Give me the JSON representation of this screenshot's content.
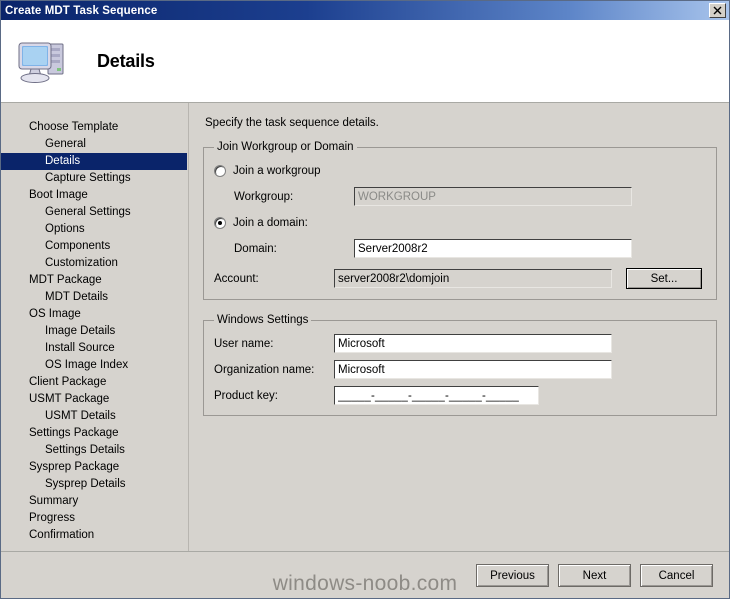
{
  "window": {
    "title": "Create MDT Task Sequence",
    "close_label": "✕"
  },
  "header": {
    "title": "Details",
    "icon": "computer-icon"
  },
  "sidebar": {
    "items": [
      {
        "label": "Choose Template",
        "level": 0,
        "selected": false
      },
      {
        "label": "General",
        "level": 1,
        "selected": false
      },
      {
        "label": "Details",
        "level": 1,
        "selected": true
      },
      {
        "label": "Capture Settings",
        "level": 1,
        "selected": false
      },
      {
        "label": "Boot Image",
        "level": 0,
        "selected": false
      },
      {
        "label": "General Settings",
        "level": 1,
        "selected": false
      },
      {
        "label": "Options",
        "level": 1,
        "selected": false
      },
      {
        "label": "Components",
        "level": 1,
        "selected": false
      },
      {
        "label": "Customization",
        "level": 1,
        "selected": false
      },
      {
        "label": "MDT Package",
        "level": 0,
        "selected": false
      },
      {
        "label": "MDT Details",
        "level": 1,
        "selected": false
      },
      {
        "label": "OS Image",
        "level": 0,
        "selected": false
      },
      {
        "label": "Image Details",
        "level": 1,
        "selected": false
      },
      {
        "label": "Install Source",
        "level": 1,
        "selected": false
      },
      {
        "label": "OS Image Index",
        "level": 1,
        "selected": false
      },
      {
        "label": "Client Package",
        "level": 0,
        "selected": false
      },
      {
        "label": "USMT Package",
        "level": 0,
        "selected": false
      },
      {
        "label": "USMT Details",
        "level": 1,
        "selected": false
      },
      {
        "label": "Settings Package",
        "level": 0,
        "selected": false
      },
      {
        "label": "Settings Details",
        "level": 1,
        "selected": false
      },
      {
        "label": "Sysprep Package",
        "level": 0,
        "selected": false
      },
      {
        "label": "Sysprep Details",
        "level": 1,
        "selected": false
      },
      {
        "label": "Summary",
        "level": 0,
        "selected": false
      },
      {
        "label": "Progress",
        "level": 0,
        "selected": false
      },
      {
        "label": "Confirmation",
        "level": 0,
        "selected": false
      }
    ]
  },
  "content": {
    "instruction": "Specify the task sequence details.",
    "join_group": {
      "legend": "Join Workgroup or Domain",
      "workgroup_radio_label": "Join a workgroup",
      "workgroup_radio_selected": false,
      "workgroup_field_label": "Workgroup:",
      "workgroup_field_value": "WORKGROUP",
      "workgroup_field_enabled": false,
      "domain_radio_label": "Join a domain:",
      "domain_radio_selected": true,
      "domain_field_label": "Domain:",
      "domain_field_value": "Server2008r2",
      "account_label": "Account:",
      "account_value": "server2008r2\\domjoin",
      "set_button_label": "Set..."
    },
    "windows_settings": {
      "legend": "Windows Settings",
      "username_label": "User name:",
      "username_value": "Microsoft",
      "organization_label": "Organization name:",
      "organization_value": "Microsoft",
      "productkey_label": "Product key:",
      "productkey_value": "_____-_____-_____-_____-_____"
    }
  },
  "footer": {
    "previous_label": "Previous",
    "next_label": "Next",
    "cancel_label": "Cancel"
  },
  "watermark": {
    "text": "windows-noob.com"
  }
}
